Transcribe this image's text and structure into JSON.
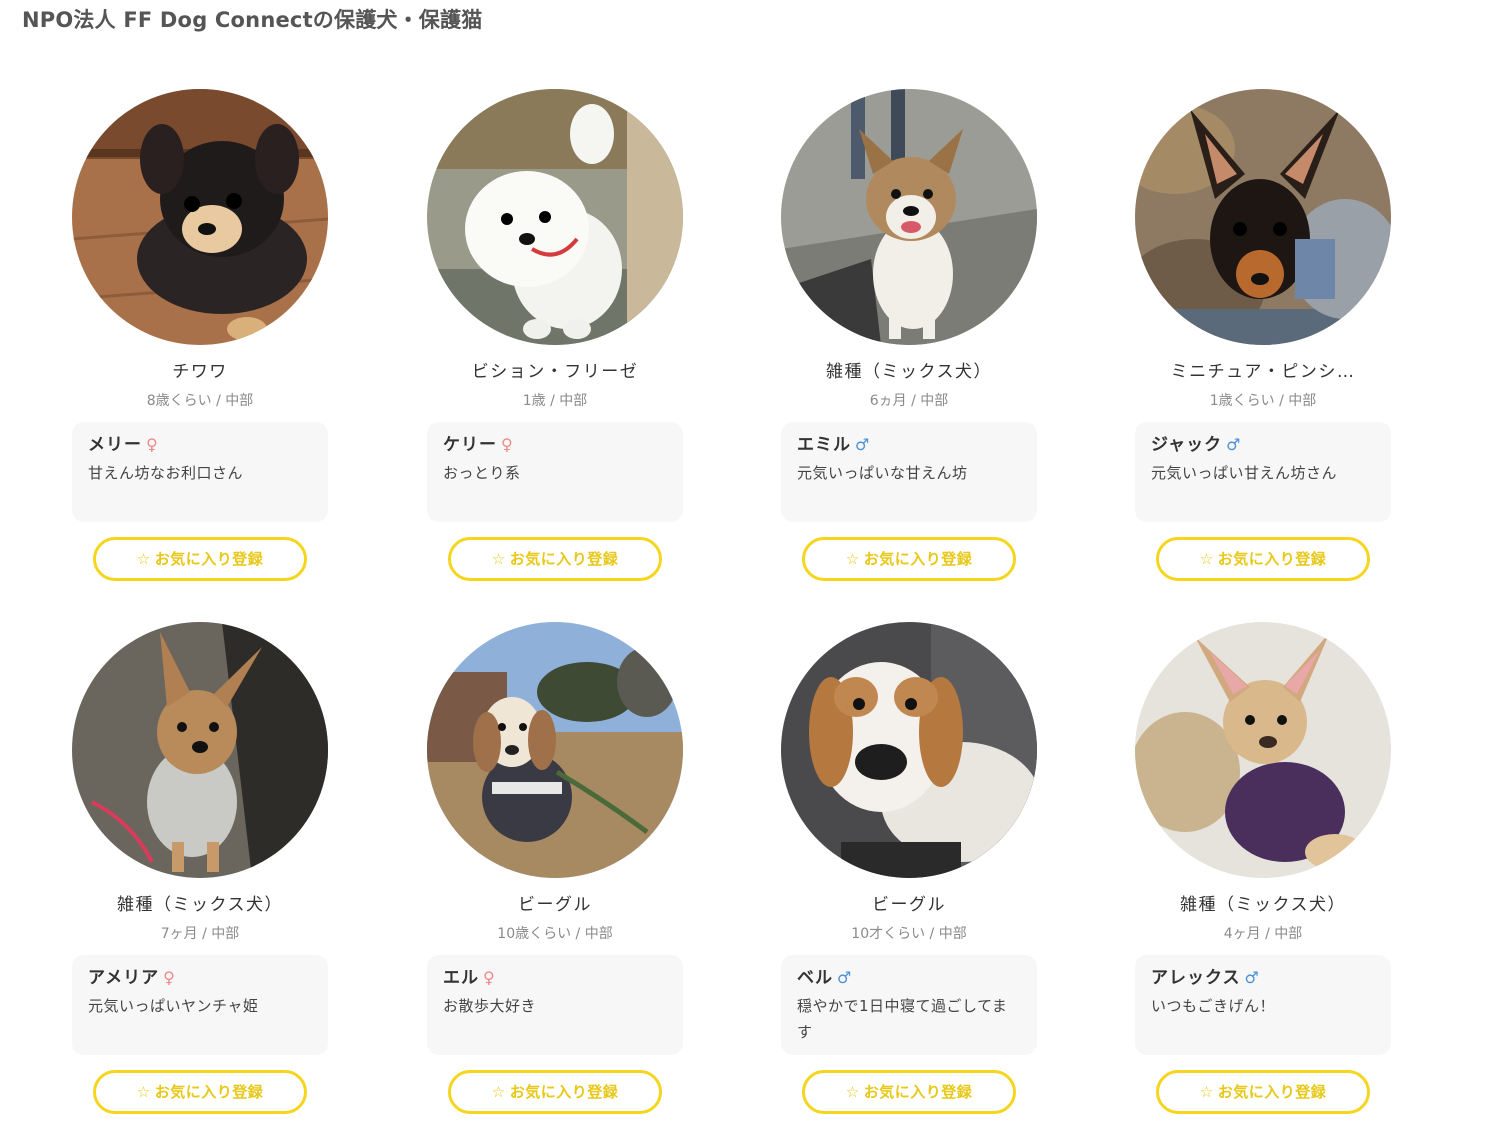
{
  "page": {
    "title": "NPO法人 FF Dog Connectの保護犬・保護猫"
  },
  "colors": {
    "accent_yellow": "#f5d51e",
    "female": "#f08a8a",
    "male": "#4a90d9",
    "card_bg": "#f7f7f7"
  },
  "favorite_label": "お気に入り登録",
  "pets": [
    {
      "breed": "チワワ",
      "meta": "8歳くらい / 中部",
      "name": "メリー",
      "sex": "♀",
      "desc": "甘えん坊なお利口さん",
      "favorite": "お気に入り登録"
    },
    {
      "breed": "ビション・フリーゼ",
      "meta": "1歳 / 中部",
      "name": "ケリー",
      "sex": "♀",
      "desc": "おっとり系",
      "favorite": "お気に入り登録"
    },
    {
      "breed": "雑種（ミックス犬）",
      "meta": "6ヵ月 / 中部",
      "name": "エミル",
      "sex": "♂",
      "desc": "元気いっぱいな甘えん坊",
      "favorite": "お気に入り登録"
    },
    {
      "breed": "ミニチュア・ピンシ…",
      "meta": "1歳くらい / 中部",
      "name": "ジャック",
      "sex": "♂",
      "desc": "元気いっぱい甘えん坊さん",
      "favorite": "お気に入り登録"
    },
    {
      "breed": "雑種（ミックス犬）",
      "meta": "7ヶ月 / 中部",
      "name": "アメリア",
      "sex": "♀",
      "desc": "元気いっぱいヤンチャ姫",
      "favorite": "お気に入り登録"
    },
    {
      "breed": "ビーグル",
      "meta": "10歳くらい / 中部",
      "name": "エル",
      "sex": "♀",
      "desc": "お散歩大好き",
      "favorite": "お気に入り登録"
    },
    {
      "breed": "ビーグル",
      "meta": "10才くらい / 中部",
      "name": "ベル",
      "sex": "♂",
      "desc": "穏やかで1日中寝て過ごしてます",
      "favorite": "お気に入り登録"
    },
    {
      "breed": "雑種（ミックス犬）",
      "meta": "4ヶ月 / 中部",
      "name": "アレックス",
      "sex": "♂",
      "desc": "いつもごきげん！",
      "favorite": "お気に入り登録"
    }
  ]
}
